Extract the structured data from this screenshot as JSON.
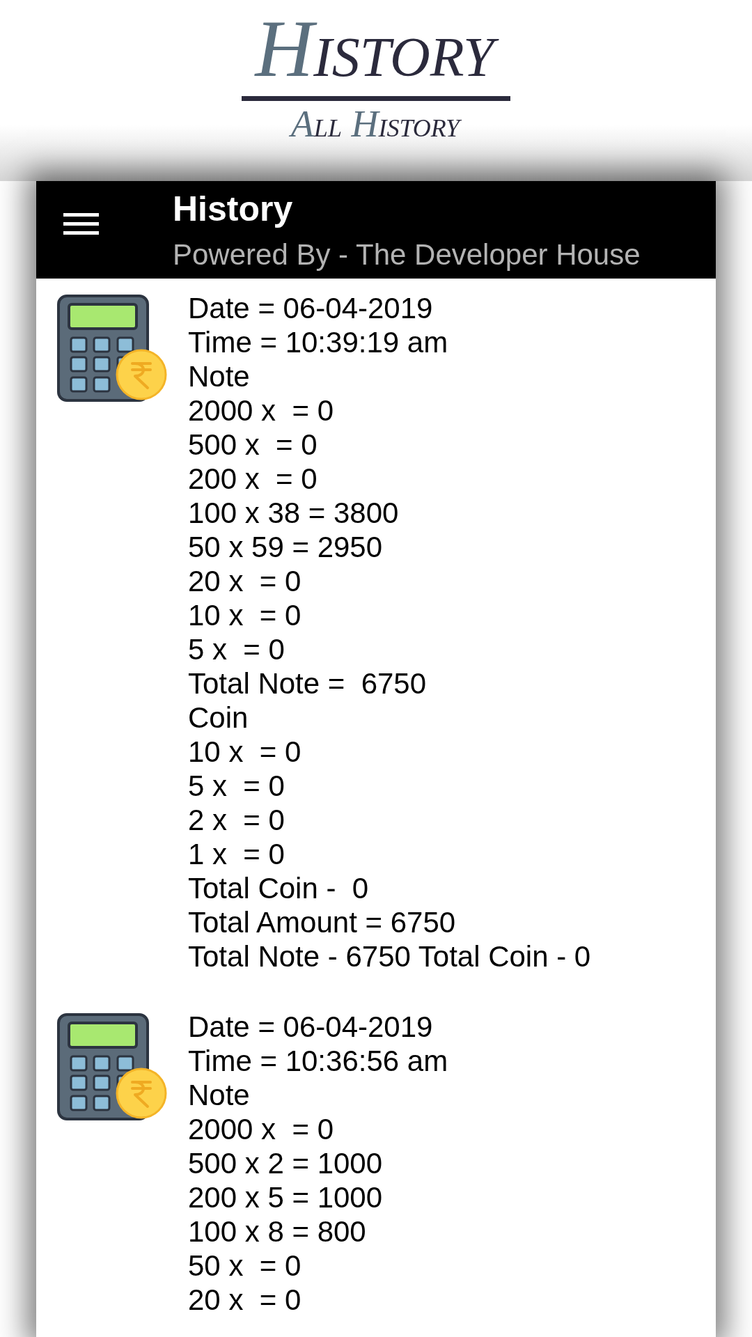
{
  "header": {
    "title": "HISTORY",
    "subtitle": "ALL HISTORY"
  },
  "app_bar": {
    "title": "History",
    "subtitle": "Powered By - The Developer House"
  },
  "history": [
    {
      "date": "Date = 06-04-2019",
      "time": "Time = 10:39:19 am",
      "note_heading": "Note",
      "notes": [
        "2000 x  = 0",
        "500 x  = 0",
        "200 x  = 0",
        "100 x 38 = 3800",
        "50 x 59 = 2950",
        "20 x  = 0",
        "10 x  = 0",
        "5 x  = 0"
      ],
      "total_note": "Total Note =  6750",
      "coin_heading": "Coin",
      "coins": [
        "10 x  = 0",
        "5 x  = 0",
        "2 x  = 0",
        "1 x  = 0"
      ],
      "total_coin": "Total Coin -  0",
      "total_amount": "Total Amount = 6750",
      "summary": "Total Note - 6750 Total Coin - 0"
    },
    {
      "date": "Date = 06-04-2019",
      "time": "Time = 10:36:56 am",
      "note_heading": "Note",
      "notes": [
        "2000 x  = 0",
        "500 x 2 = 1000",
        "200 x 5 = 1000",
        "100 x 8 = 800",
        "50 x  = 0",
        "20 x  = 0"
      ]
    }
  ]
}
